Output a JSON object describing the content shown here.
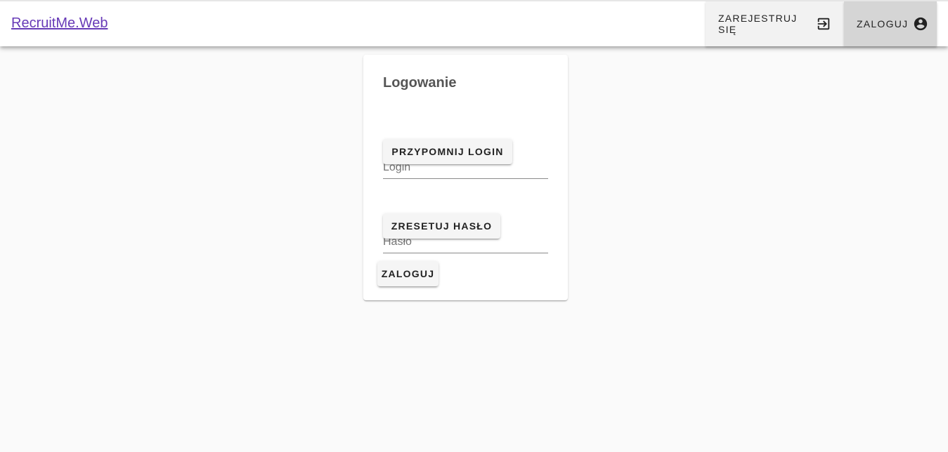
{
  "header": {
    "brand": "RecruitMe.Web",
    "register_label": "ZAREJESTRUJ SIĘ",
    "register_icon": "login-box-icon",
    "login_label": "ZALOGUJ",
    "login_icon": "account-circle-icon"
  },
  "login_card": {
    "title": "Logowanie",
    "login_placeholder": "Login",
    "login_value": "",
    "remind_login_label": "PRZYPOMNIJ LOGIN",
    "password_placeholder": "Hasło",
    "password_value": "",
    "reset_password_label": "ZRESETUJ HASŁO",
    "submit_label": "ZALOGUJ"
  },
  "colors": {
    "brand_link": "#673ab7",
    "background": "#fafafa",
    "active_nav": "#d5d5d5"
  }
}
